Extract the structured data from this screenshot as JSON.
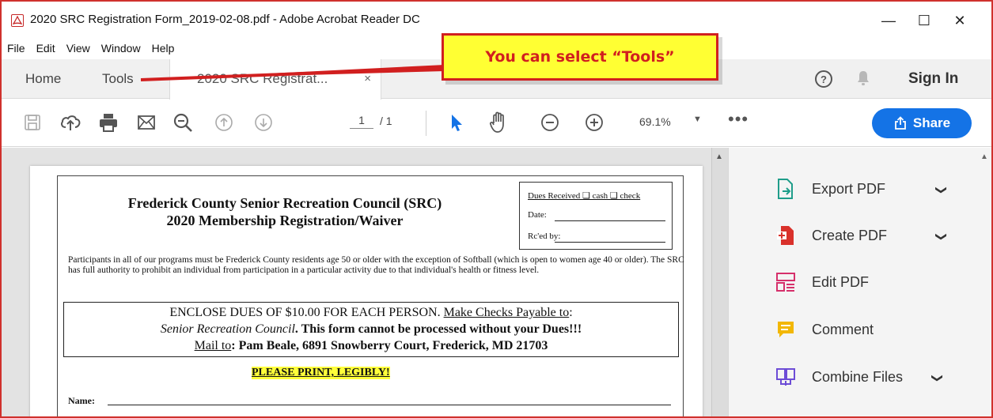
{
  "window": {
    "title": "2020 SRC Registration  Form_2019-02-08.pdf - Adobe Acrobat Reader DC",
    "min_glyph": "—",
    "max_glyph": "☐",
    "close_glyph": "✕"
  },
  "menu": [
    {
      "label": "File"
    },
    {
      "label": "Edit"
    },
    {
      "label": "View"
    },
    {
      "label": "Window"
    },
    {
      "label": "Help"
    }
  ],
  "tabs": {
    "home": "Home",
    "tools": "Tools",
    "doc": "2020 SRC Registrat...",
    "doc_close": "×"
  },
  "header": {
    "help_glyph": "?",
    "sign_in": "Sign In"
  },
  "toolbar": {
    "page_current": "1",
    "page_total": "/ 1",
    "zoom": "69.1%",
    "zoom_caret": "▼",
    "more": "•••",
    "share": "Share"
  },
  "document": {
    "org_title_1": "Frederick County Senior Recreation Council (SRC)",
    "org_title_2": "2020 Membership Registration/Waiver",
    "dues_received": "Dues Received ❏ cash  ❏ check",
    "dues_date": "Date:",
    "dues_rced": "Rc'ed by:",
    "intro": "Participants in all of our programs must be Frederick County residents age 50 or older with the exception of Softball (which is open to women age 40 or older).  The SRC has full authority to prohibit an individual from participation in a particular activity due to that individual's health or fitness level.",
    "enclose_1a": "ENCLOSE DUES OF $10.00 FOR EACH PERSON.  ",
    "enclose_1b": "Make Checks Payable to",
    "enclose_1c": ":",
    "enclose_2a": "Senior Recreation Council",
    "enclose_2b": ".   This form cannot be processed without your Dues!!!",
    "enclose_3a": "Mail to",
    "enclose_3b": ":  Pam Beale, 6891 Snowberry Court,  Frederick, MD 21703",
    "print_note": "PLEASE PRINT, LEGIBLY!",
    "name_label": "Name:"
  },
  "tools_panel": [
    {
      "label": "Export PDF",
      "icon": "export-pdf-icon",
      "chevron": "❯",
      "color": "#1f9d8a"
    },
    {
      "label": "Create PDF",
      "icon": "create-pdf-icon",
      "chevron": "❯",
      "color": "#d9312b"
    },
    {
      "label": "Edit PDF",
      "icon": "edit-pdf-icon",
      "chevron": "",
      "color": "#d6306b"
    },
    {
      "label": "Comment",
      "icon": "comment-icon",
      "chevron": "",
      "color": "#f2b705"
    },
    {
      "label": "Combine Files",
      "icon": "combine-files-icon",
      "chevron": "❯",
      "color": "#6d4cd6"
    }
  ],
  "annotation": {
    "text": "You can select “Tools”",
    "fill": "#ffff33",
    "border": "#d11f1f"
  },
  "colors": {
    "accent": "#1473e6",
    "window_border": "#d0312d",
    "pointer": "#1473e6"
  }
}
